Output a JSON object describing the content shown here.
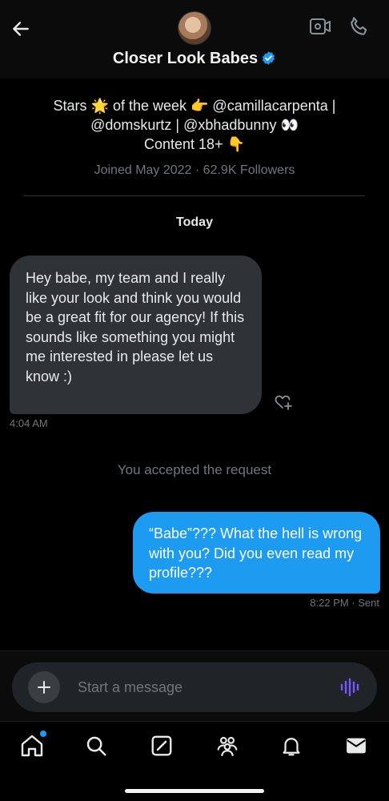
{
  "header": {
    "name": "Closer Look Babes",
    "verified": true
  },
  "profile": {
    "bio_line1": "Stars 🌟 of the week 👉 @camillacarpenta |",
    "bio_line2": "@domskurtz | @xbhadbunny 👀",
    "bio_line3": "Content 18+ 👇",
    "meta": "Joined May 2022 · 62.9K Followers"
  },
  "conversation": {
    "date_separator": "Today",
    "incoming": {
      "text": "Hey babe, my team and I really like your look and think you would be a great fit for our agency! If this sounds like something you might me interested in please let us know :)",
      "time": "4:04 AM"
    },
    "system": "You accepted the request",
    "outgoing": {
      "text": "“Babe”??? What the hell is wrong with you? Did you even read my profile???",
      "status": "8:22 PM · Sent"
    }
  },
  "composer": {
    "placeholder": "Start a message"
  },
  "colors": {
    "accent": "#1d9bf0",
    "voice": "#7856ff",
    "bubble_in": "#2f3336",
    "muted": "#71767b"
  },
  "icons": [
    "back-arrow-icon",
    "verified-badge-icon",
    "video-call-icon",
    "phone-icon",
    "heart-plus-icon",
    "plus-icon",
    "voice-wave-icon",
    "home-icon",
    "search-icon",
    "grok-icon",
    "communities-icon",
    "bell-icon",
    "mail-icon"
  ]
}
